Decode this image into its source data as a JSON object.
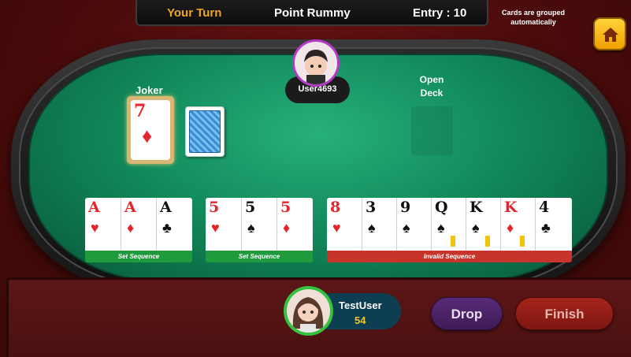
{
  "header": {
    "turn_label": "Your Turn",
    "game_type": "Point Rummy",
    "entry": "Entry : 10",
    "grouped_note": "Cards are grouped automatically"
  },
  "opponent": {
    "name": "User4693"
  },
  "table": {
    "joker_label": "Joker",
    "joker_card": {
      "rank": "7",
      "suit": "♦"
    },
    "open_deck_label": "Open Deck"
  },
  "groups": [
    {
      "label": "Set Sequence",
      "status": "valid",
      "cards": [
        {
          "rank": "A",
          "suit": "♥"
        },
        {
          "rank": "A",
          "suit": "♦"
        },
        {
          "rank": "A",
          "suit": "♣"
        }
      ]
    },
    {
      "label": "Set Sequence",
      "status": "valid",
      "cards": [
        {
          "rank": "5",
          "suit": "♥"
        },
        {
          "rank": "5",
          "suit": "♠"
        },
        {
          "rank": "5",
          "suit": "♦"
        }
      ]
    },
    {
      "label": "Invalid Sequence",
      "status": "invalid",
      "cards": [
        {
          "rank": "8",
          "suit": "♥"
        },
        {
          "rank": "3",
          "suit": "♠"
        },
        {
          "rank": "9",
          "suit": "♠"
        },
        {
          "rank": "Q",
          "suit": "♠"
        },
        {
          "rank": "K",
          "suit": "♠"
        },
        {
          "rank": "K",
          "suit": "♦"
        },
        {
          "rank": "4",
          "suit": "♣"
        }
      ]
    }
  ],
  "player": {
    "name": "TestUser",
    "score": "54"
  },
  "actions": {
    "drop_label": "Drop",
    "finish_label": "Finish"
  },
  "icons": {
    "home": "home-icon"
  },
  "colors": {
    "turn": "#f0a51e",
    "valid": "#1f9a3d",
    "invalid": "#c8342b",
    "player_ring": "#35c23f",
    "opponent_ring": "#b23bc6"
  }
}
